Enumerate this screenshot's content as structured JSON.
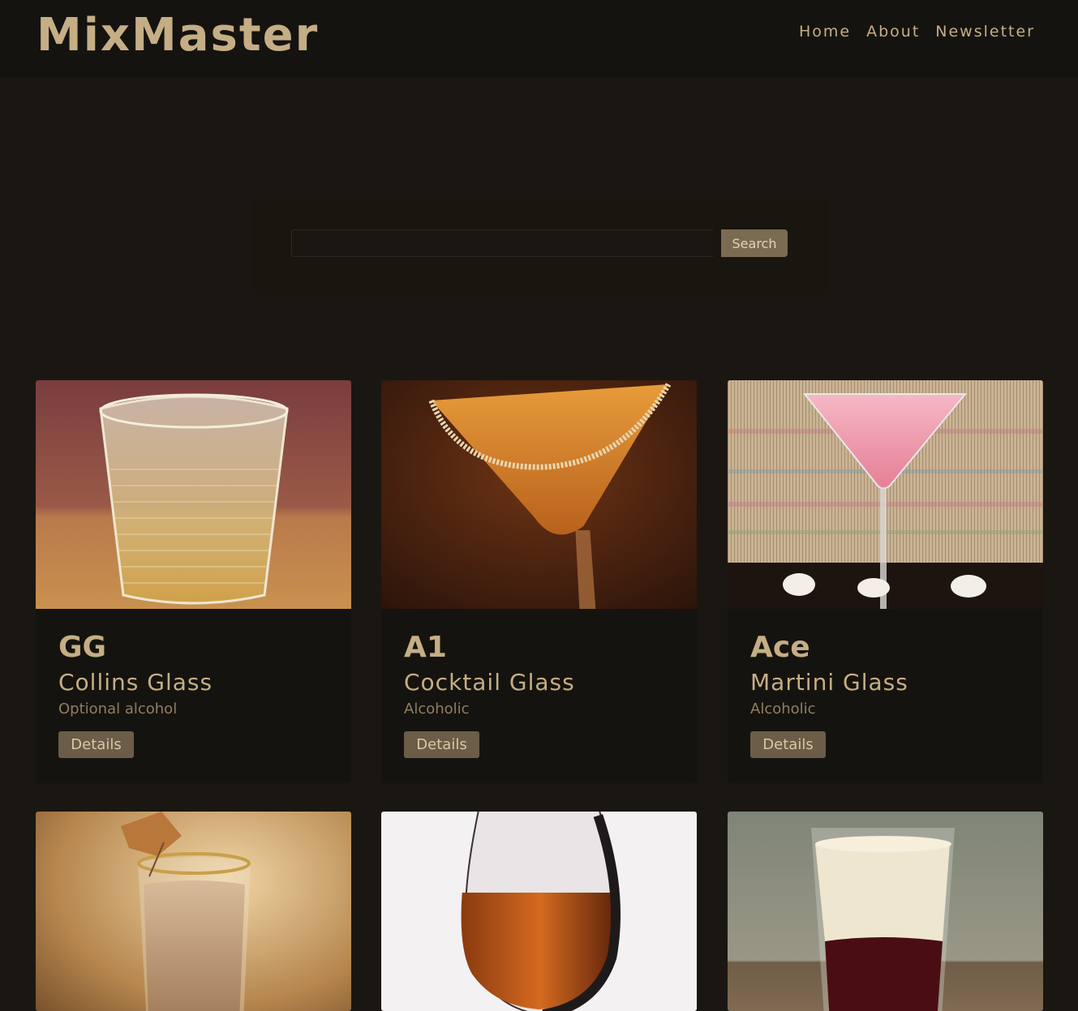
{
  "brand": "MixMaster",
  "nav": {
    "items": [
      {
        "label": "Home"
      },
      {
        "label": "About"
      },
      {
        "label": "Newsletter"
      }
    ]
  },
  "search": {
    "value": "",
    "placeholder": "",
    "button_label": "Search"
  },
  "cards": [
    {
      "name": "GG",
      "glass": "Collins Glass",
      "type": "Optional alcohol",
      "button": "Details"
    },
    {
      "name": "A1",
      "glass": "Cocktail Glass",
      "type": "Alcoholic",
      "button": "Details"
    },
    {
      "name": "Ace",
      "glass": "Martini Glass",
      "type": "Alcoholic",
      "button": "Details"
    },
    {
      "name": "",
      "glass": "",
      "type": "",
      "button": ""
    },
    {
      "name": "",
      "glass": "",
      "type": "",
      "button": ""
    },
    {
      "name": "",
      "glass": "",
      "type": "",
      "button": ""
    }
  ],
  "colors": {
    "background": "#1a1712",
    "accent": "#c5ae85",
    "button": "#6b5d47"
  }
}
